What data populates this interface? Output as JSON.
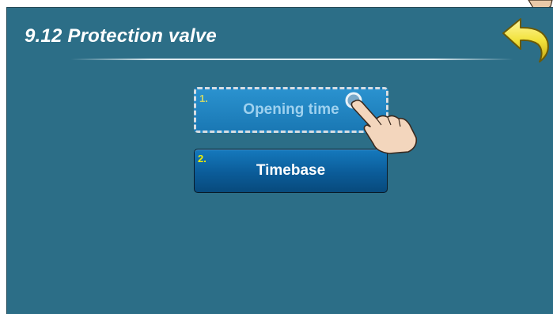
{
  "header": {
    "title": "9.12 Protection valve"
  },
  "menu": {
    "items": [
      {
        "number": "1.",
        "label": "Opening time",
        "selected": true
      },
      {
        "number": "2.",
        "label": "Timebase",
        "selected": false
      }
    ]
  },
  "icons": {
    "back": "back-arrow-icon",
    "pointer": "hand-pointer-icon"
  },
  "colors": {
    "background": "#2c6e87",
    "button": "#0b5c99",
    "selected_button": "#2a92cf",
    "back_arrow": "#f0e040"
  }
}
